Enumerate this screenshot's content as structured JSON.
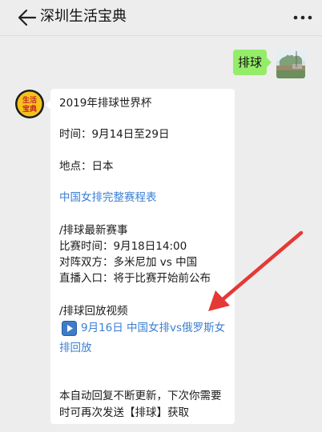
{
  "header": {
    "title": "深圳生活宝典"
  },
  "user_message": {
    "text": "排球"
  },
  "bot": {
    "avatar_text": [
      "生活",
      "宝典"
    ],
    "lines": {
      "l1": "2019年排球世界杯",
      "l2": "时间：9月14日至29日",
      "l3": "地点：日本",
      "l4": "中国女排完整赛程表",
      "l5": "/排球最新赛事",
      "l6": "比赛时间：9月18日14:00",
      "l7": "对阵双方：多米尼加 vs 中国",
      "l8": "直播入口：将于比赛开始前公布",
      "l9": "/排球回放视频",
      "l10": "9月16日 中国女排vs俄罗斯女",
      "l11": "排回放",
      "l12": "本自动回复不断更新，下次你需要",
      "l13": "时可再次发送【排球】获取"
    }
  },
  "colors": {
    "background": "#ededed",
    "user_bubble": "#95ec69",
    "link": "#3b7fd1",
    "arrow": "#e53935",
    "avatar_bg": "#f6c21a",
    "avatar_text": "#c62828"
  }
}
